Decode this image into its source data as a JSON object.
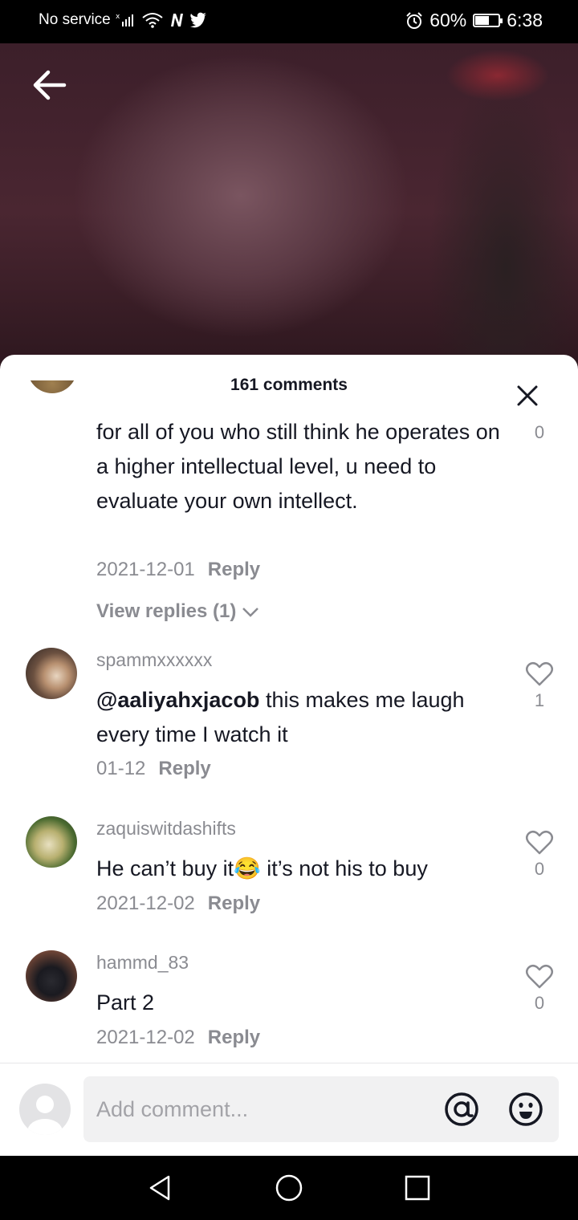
{
  "status_bar": {
    "carrier": "No service",
    "battery": "60%",
    "battery_level": 0.6,
    "time": "6:38"
  },
  "sheet": {
    "title": "161 comments",
    "close_icon": "close-icon"
  },
  "comments": [
    {
      "text": "for all of you who still think he operates on a higher intellectual level, u need to evaluate your own intellect.",
      "date": "2021-12-01",
      "reply": "Reply",
      "likes": "0",
      "view_replies": "View replies (1)"
    },
    {
      "username": "spammxxxxxx",
      "mention": "@aaliyahxjacob",
      "text": " this makes me laugh every time I watch it",
      "date": "01-12",
      "reply": "Reply",
      "likes": "1"
    },
    {
      "username": "zaquiswitdashifts",
      "text_before": "He can’t buy it",
      "emoji": "😂",
      "text_after": " it’s not his to buy",
      "date": "2021-12-02",
      "reply": "Reply",
      "likes": "0"
    },
    {
      "username": "hammd_83",
      "text": "Part 2",
      "date": "2021-12-02",
      "reply": "Reply",
      "likes": "0"
    }
  ],
  "input": {
    "placeholder": "Add comment..."
  },
  "icons": {
    "back": "back-arrow-icon",
    "like": "heart-icon",
    "mention": "at-icon",
    "emoji": "emoji-icon",
    "nav_back": "triangle-back-icon",
    "nav_home": "circle-home-icon",
    "nav_recents": "square-recents-icon"
  },
  "colors": {
    "text_primary": "#161823",
    "text_secondary": "#8a8b91",
    "input_bg": "#f1f1f2"
  }
}
